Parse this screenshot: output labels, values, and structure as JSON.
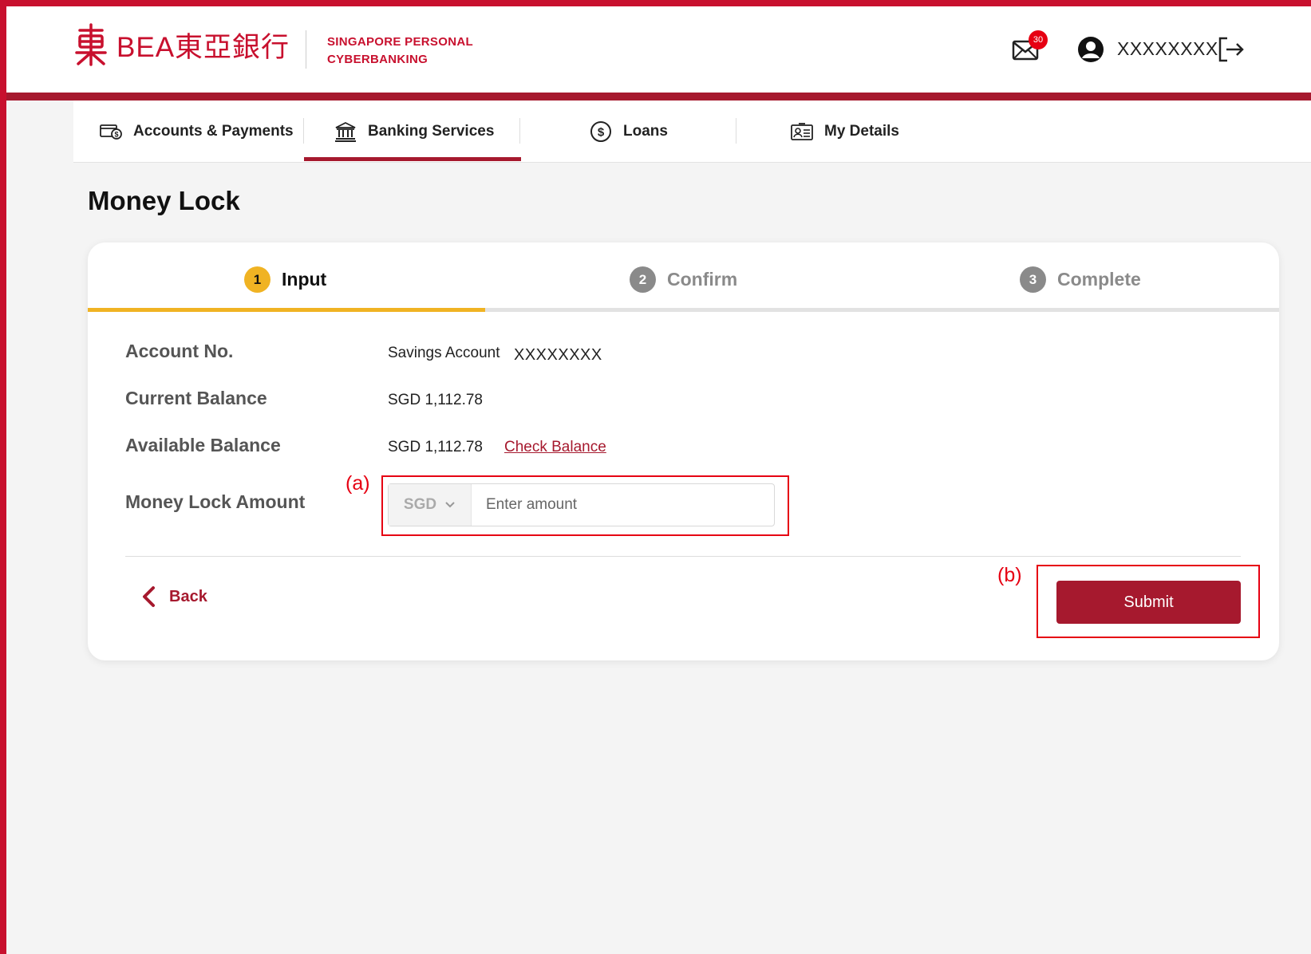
{
  "header": {
    "brand": "BEA東亞銀行",
    "subtitle_line1": "SINGAPORE PERSONAL",
    "subtitle_line2": "CYBERBANKING",
    "mail_badge_count": "30",
    "username": "XXXXXXXX"
  },
  "nav": {
    "items": [
      {
        "label": "Accounts & Payments",
        "icon": "card-payment-icon",
        "active": false
      },
      {
        "label": "Banking Services",
        "icon": "bank-icon",
        "active": true
      },
      {
        "label": "Loans",
        "icon": "dollar-circle-icon",
        "active": false
      },
      {
        "label": "My Details",
        "icon": "id-card-icon",
        "active": false
      }
    ]
  },
  "page": {
    "title": "Money Lock"
  },
  "steps": [
    {
      "num": "1",
      "label": "Input",
      "active": true
    },
    {
      "num": "2",
      "label": "Confirm",
      "active": false
    },
    {
      "num": "3",
      "label": "Complete",
      "active": false
    }
  ],
  "form": {
    "account_label": "Account No.",
    "account_type": "Savings Account",
    "account_number": "XXXXXXXX",
    "current_balance_label": "Current Balance",
    "current_balance_value": "SGD 1,112.78",
    "available_balance_label": "Available Balance",
    "available_balance_value": "SGD 1,112.78",
    "check_balance_link": "Check Balance",
    "amount_label": "Money Lock Amount",
    "currency": "SGD",
    "amount_value": "",
    "amount_placeholder": "Enter amount"
  },
  "actions": {
    "back_label": "Back",
    "submit_label": "Submit"
  },
  "annotations": {
    "a": "(a)",
    "b": "(b)"
  },
  "colors": {
    "brand_red": "#c8102e",
    "accent_maroon": "#a6192e",
    "step_active": "#f0b323",
    "step_inactive": "#888888",
    "annotation_red": "#e60012"
  }
}
